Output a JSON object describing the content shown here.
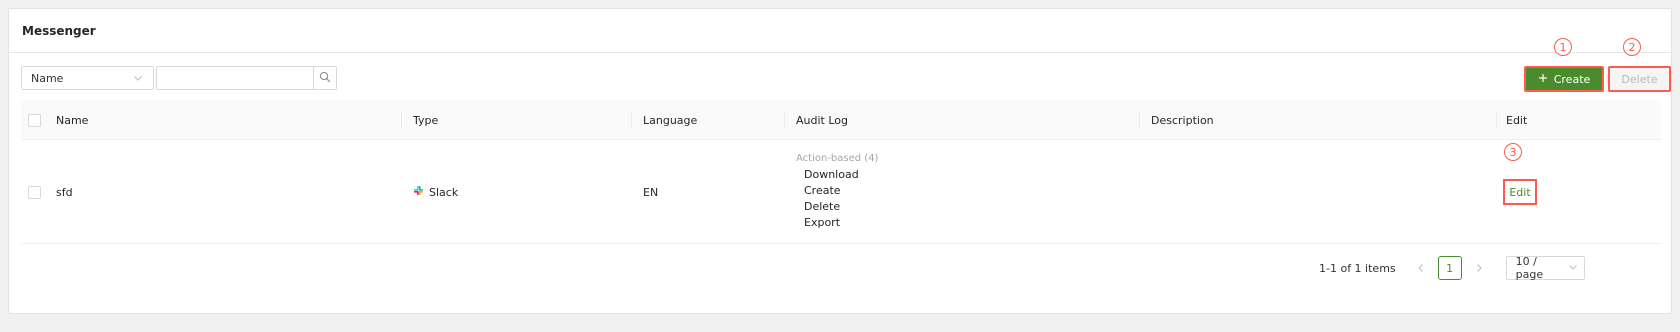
{
  "header": {
    "title": "Messenger"
  },
  "filter": {
    "field_label": "Name",
    "search_value": "",
    "search_placeholder": ""
  },
  "toolbar": {
    "create_label": "Create",
    "delete_label": "Delete"
  },
  "markers": {
    "m1": "1",
    "m2": "2",
    "m3": "3"
  },
  "table": {
    "columns": {
      "name": "Name",
      "type": "Type",
      "language": "Language",
      "audit_log": "Audit Log",
      "description": "Description",
      "edit": "Edit"
    },
    "rows": [
      {
        "name": "sfd",
        "type": "Slack",
        "language": "EN",
        "audit_group": "Action-based (4)",
        "audit_items": [
          "Download",
          "Create",
          "Delete",
          "Export"
        ],
        "description": "",
        "edit_label": "Edit"
      }
    ]
  },
  "pagination": {
    "total_text": "1-1 of 1 items",
    "current_page": "1",
    "page_size": "10 / page"
  },
  "colors": {
    "accent": "#4a8c2c",
    "highlight": "#ff5a4f"
  }
}
